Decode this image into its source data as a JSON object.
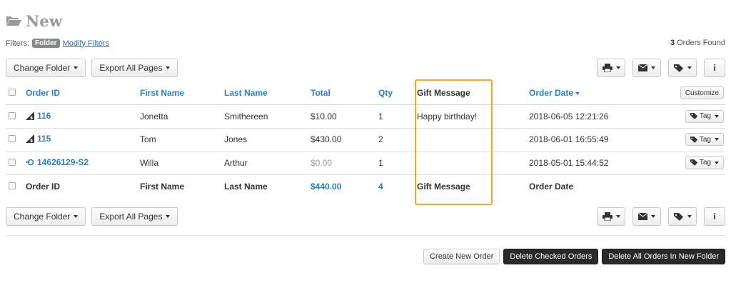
{
  "header": {
    "title": "New"
  },
  "filters": {
    "label": "Filters:",
    "badge": "Folder",
    "modify_link": "Modify Filters"
  },
  "orders_found": {
    "count": "3",
    "label": "Orders Found"
  },
  "toolbar": {
    "change_folder": "Change Folder",
    "export_all_pages": "Export All Pages",
    "print_icon": "printer-icon",
    "email_icon": "envelope-icon",
    "tag_icon": "tag-icon",
    "info_label": "i"
  },
  "table": {
    "headers": {
      "order_id": "Order ID",
      "first_name": "First Name",
      "last_name": "Last Name",
      "total": "Total",
      "qty": "Qty",
      "gift_message": "Gift Message",
      "order_date": "Order Date",
      "customize": "Customize"
    },
    "rows": [
      {
        "order_id": "116",
        "source_icon": "marketplace-icon",
        "first_name": "Jonetta",
        "last_name": "Smithereen",
        "total": "$10.00",
        "qty": "1",
        "gift_message": "Happy birthday!",
        "order_date": "2018-06-05 12:21:26",
        "tag_label": "Tag"
      },
      {
        "order_id": "115",
        "source_icon": "marketplace-icon",
        "first_name": "Tom",
        "last_name": "Jones",
        "total": "$430.00",
        "qty": "2",
        "gift_message": "",
        "order_date": "2018-06-01 16:55:49",
        "tag_label": "Tag"
      },
      {
        "order_id": "14626129-S2",
        "source_icon": "split-order-icon",
        "first_name": "Willa",
        "last_name": "Arthur",
        "total": "$0.00",
        "qty": "1",
        "gift_message": "",
        "order_date": "2018-05-01 15:44:52",
        "tag_label": "Tag"
      }
    ],
    "footer": {
      "order_id": "Order ID",
      "first_name": "First Name",
      "last_name": "Last Name",
      "total": "$440.00",
      "qty": "4",
      "gift_message": "Gift Message",
      "order_date": "Order Date"
    }
  },
  "actions": {
    "create_new_order": "Create New Order",
    "delete_checked": "Delete Checked Orders",
    "delete_all_new_folder": "Delete All Orders In New Folder"
  },
  "colors": {
    "link": "#2a7fc1",
    "highlight": "#f7a823",
    "dark_button": "#2a2a2a"
  }
}
